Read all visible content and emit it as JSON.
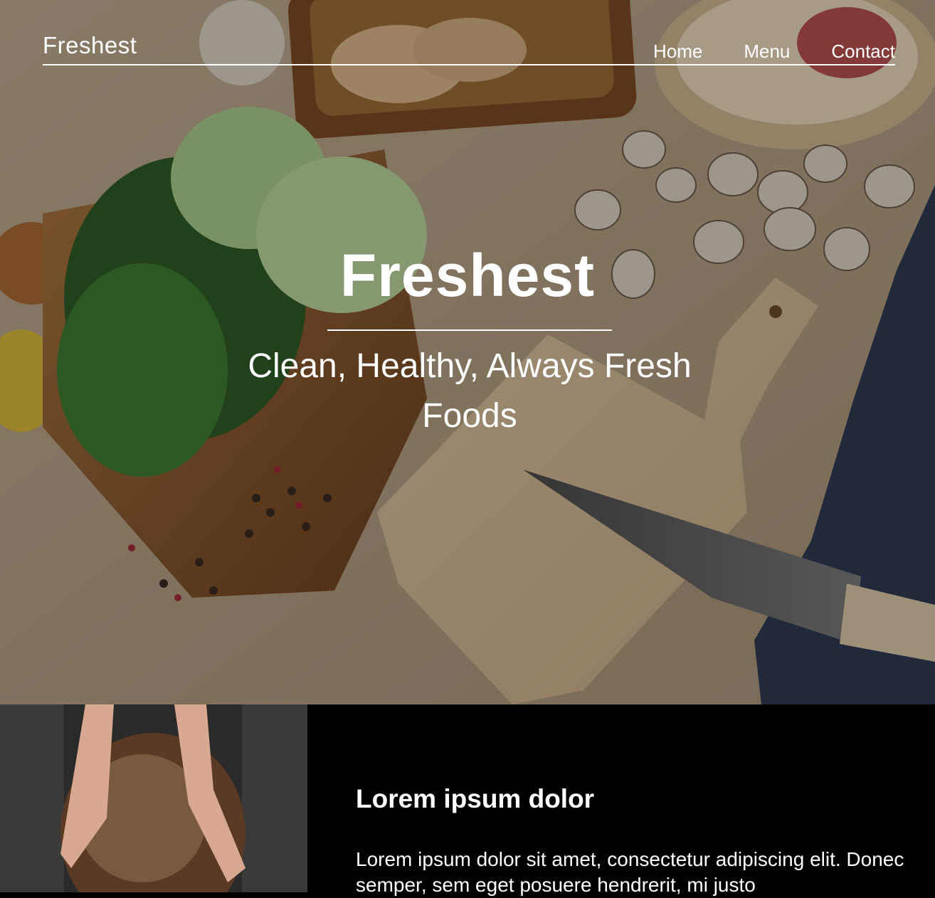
{
  "nav": {
    "brand": "Freshest",
    "links": [
      "Home",
      "Menu",
      "Contact"
    ]
  },
  "hero": {
    "title": "Freshest",
    "subtitle": "Clean, Healthy, Always Fresh Foods"
  },
  "feature": {
    "heading": "Lorem ipsum dolor",
    "text": "Lorem ipsum dolor sit amet, consectetur adipiscing elit. Donec semper, sem eget posuere hendrerit, mi justo"
  },
  "colors": {
    "text": "#ffffff",
    "panel": "#000000"
  }
}
